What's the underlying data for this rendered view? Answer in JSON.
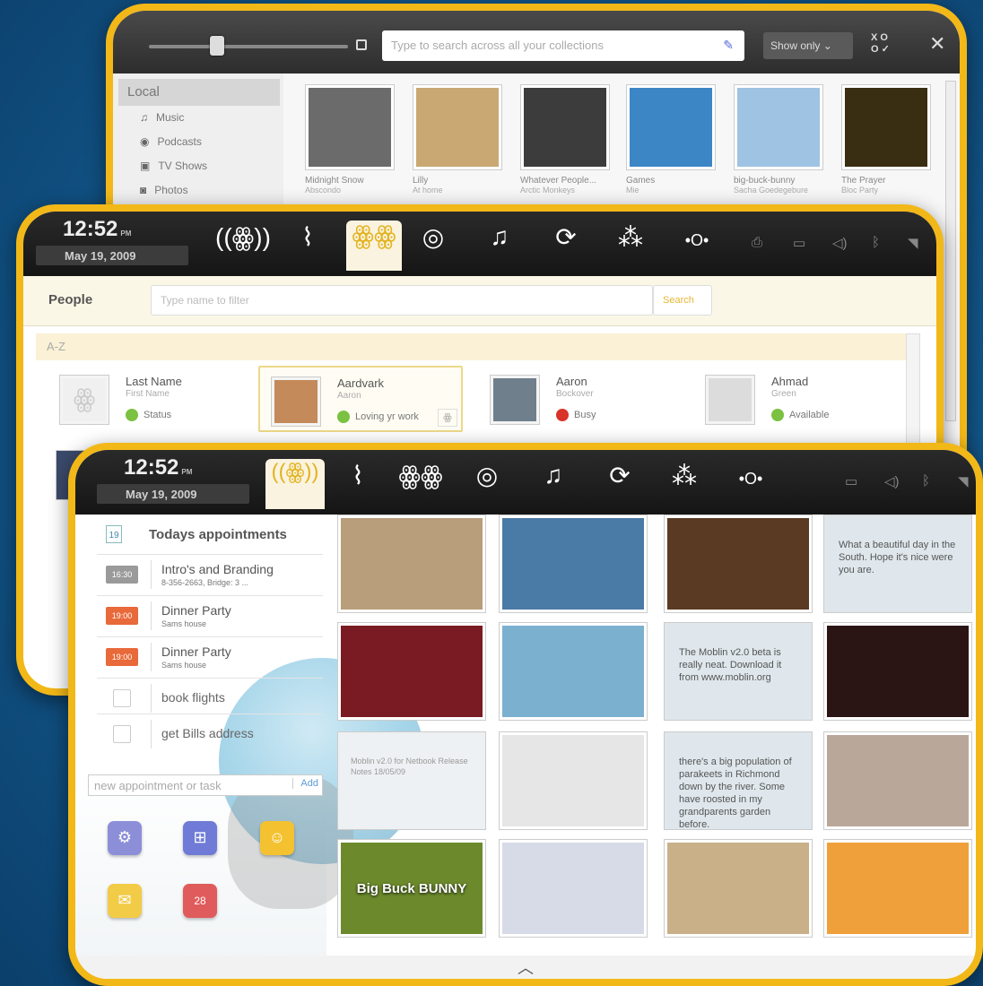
{
  "media": {
    "search_placeholder": "Type to search across all your collections",
    "show_only": "Show only",
    "sidebar_heading": "Local",
    "sidebar_items": [
      {
        "icon": "music-icon",
        "glyph": "♫",
        "label": "Music"
      },
      {
        "icon": "podcast-icon",
        "glyph": "◉",
        "label": "Podcasts"
      },
      {
        "icon": "tv-icon",
        "glyph": "▣",
        "label": "TV Shows"
      },
      {
        "icon": "photo-icon",
        "glyph": "◙",
        "label": "Photos"
      }
    ],
    "items": [
      {
        "title": "Midnight Snow",
        "subtitle": "Abscondo",
        "color": "#6b6b6b"
      },
      {
        "title": "Lilly",
        "subtitle": "At home",
        "color": "#c9a873"
      },
      {
        "title": "Whatever People...",
        "subtitle": "Arctic Monkeys",
        "color": "#3c3c3c"
      },
      {
        "title": "Games",
        "subtitle": "Mie",
        "color": "#3d86c6"
      },
      {
        "title": "big-buck-bunny",
        "subtitle": "Sacha Goedegebure",
        "color": "#9fc3e2"
      },
      {
        "title": "The Prayer",
        "subtitle": "Bloc Party",
        "color": "#3a2e12"
      }
    ]
  },
  "topbar": {
    "time": "12:52",
    "ampm": "PM",
    "date": "May 19, 2009",
    "icons": [
      {
        "name": "myzone-icon",
        "glyph": "((ꙮ))"
      },
      {
        "name": "status-icon",
        "glyph": "⌇"
      },
      {
        "name": "people-icon",
        "glyph": "ꙮꙮ"
      },
      {
        "name": "internet-icon",
        "glyph": "◎"
      },
      {
        "name": "media-icon",
        "glyph": "♫"
      },
      {
        "name": "pasteboard-icon",
        "glyph": "⟳"
      },
      {
        "name": "applications-icon",
        "glyph": "⁂"
      },
      {
        "name": "zones-icon",
        "glyph": "•O•"
      }
    ]
  },
  "people": {
    "label": "People",
    "filter_placeholder": "Type name to filter",
    "search_button": "Search",
    "section": "A-Z",
    "contacts": [
      {
        "name": "Last Name",
        "first": "First Name",
        "status": "Status",
        "status_color": "#7bc142",
        "avatar_color": "#f0f0f0"
      },
      {
        "name": "Aardvark",
        "first": "Aaron",
        "status": "Loving yr work",
        "status_color": "#7bc142",
        "avatar_color": "#c48a5a"
      },
      {
        "name": "Aaron",
        "first": "Bockover",
        "status": "Busy",
        "status_color": "#d8322a",
        "avatar_color": "#6f7f8c"
      },
      {
        "name": "Ahmad",
        "first": "Green",
        "status": "Available",
        "status_color": "#7bc142",
        "avatar_color": "#dcdcdc"
      }
    ]
  },
  "myzone": {
    "appointments_title": "Todays appointments",
    "calendar_day": "19",
    "appointments": [
      {
        "time": "16:30",
        "title": "Intro's and Branding",
        "detail": "8-356-2663, Bridge: 3 ...",
        "color": "#9a9a9a"
      },
      {
        "time": "19:00",
        "title": "Dinner Party",
        "detail": "Sams house",
        "color": "#e8693a"
      },
      {
        "time": "19:00",
        "title": "Dinner Party",
        "detail": "Sams house",
        "color": "#e8693a"
      }
    ],
    "tasks": [
      "book flights",
      "get Bills address"
    ],
    "new_placeholder": "new appointment or task",
    "add_label": "Add",
    "apps": [
      {
        "name": "settings-app-icon",
        "glyph": "⚙",
        "color": "#8c8fd8"
      },
      {
        "name": "network-app-icon",
        "glyph": "⊞",
        "color": "#6f7bd6"
      },
      {
        "name": "chat-app-icon",
        "glyph": "☺",
        "color": "#f4c230"
      },
      {
        "name": "mail-app-icon",
        "glyph": "✉",
        "color": "#f2cb47"
      },
      {
        "name": "calendar-app-icon",
        "glyph": "28",
        "color": "#e05b5b"
      }
    ],
    "tiles": [
      {
        "kind": "photo",
        "color": "#b89e7a"
      },
      {
        "kind": "photo",
        "color": "#4a7aa6"
      },
      {
        "kind": "photo",
        "color": "#5a3a22"
      },
      {
        "kind": "text",
        "text": "What a beautiful day in the South. Hope it's nice were you are."
      },
      {
        "kind": "photo",
        "color": "#7a1a22"
      },
      {
        "kind": "photo",
        "color": "#7bb0cf"
      },
      {
        "kind": "text",
        "text": "The Moblin v2.0 beta is really neat. Download it from www.moblin.org"
      },
      {
        "kind": "photo",
        "color": "#2b1414"
      },
      {
        "kind": "doc",
        "text": "Moblin v2.0 for Netbook Release Notes 18/05/09"
      },
      {
        "kind": "photo",
        "color": "#e6e6e6"
      },
      {
        "kind": "text",
        "text": "there's a big population of parakeets in Richmond down by the river. Some have roosted in my grandparents garden before."
      },
      {
        "kind": "photo",
        "color": "#b9a89a"
      },
      {
        "kind": "photo",
        "color": "#6c8a2c",
        "label": "Big Buck BUNNY"
      },
      {
        "kind": "photo",
        "color": "#d7dbe7"
      },
      {
        "kind": "photo",
        "color": "#c9b089"
      },
      {
        "kind": "photo",
        "color": "#f0a03a"
      }
    ]
  }
}
